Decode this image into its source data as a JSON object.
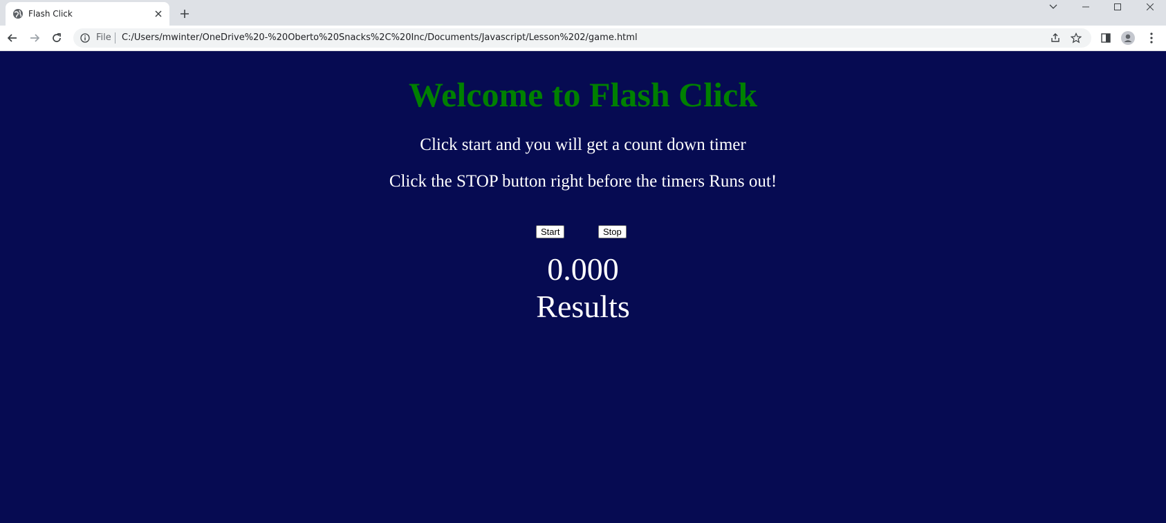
{
  "browser": {
    "tab": {
      "title": "Flash Click",
      "favicon": "globe-icon",
      "close_icon": "close-icon"
    },
    "new_tab_icon": "plus-icon",
    "window_controls": [
      "chevron-down-icon",
      "minimize-icon",
      "maximize-icon",
      "close-icon"
    ],
    "nav": {
      "back": "back-arrow-icon",
      "forward": "forward-arrow-icon",
      "reload": "reload-icon"
    },
    "omnibox": {
      "scheme_label": "File",
      "url": "C:/Users/mwinter/OneDrive%20-%20Oberto%20Snacks%2C%20Inc/Documents/Javascript/Lesson%202/game.html",
      "actions": [
        "share-icon",
        "star-icon"
      ]
    },
    "toolbar_actions": [
      "side-panel-icon",
      "profile-icon",
      "more-menu-icon"
    ]
  },
  "page": {
    "background": "#060b52",
    "heading": "Welcome to Flash Click",
    "heading_color": "#008000",
    "instruction_1": "Click start and you will get a count down timer",
    "instruction_2": "Click the STOP button right before the timers Runs out!",
    "start_label": "Start",
    "stop_label": "Stop",
    "timer": "0.000",
    "results": "Results"
  }
}
